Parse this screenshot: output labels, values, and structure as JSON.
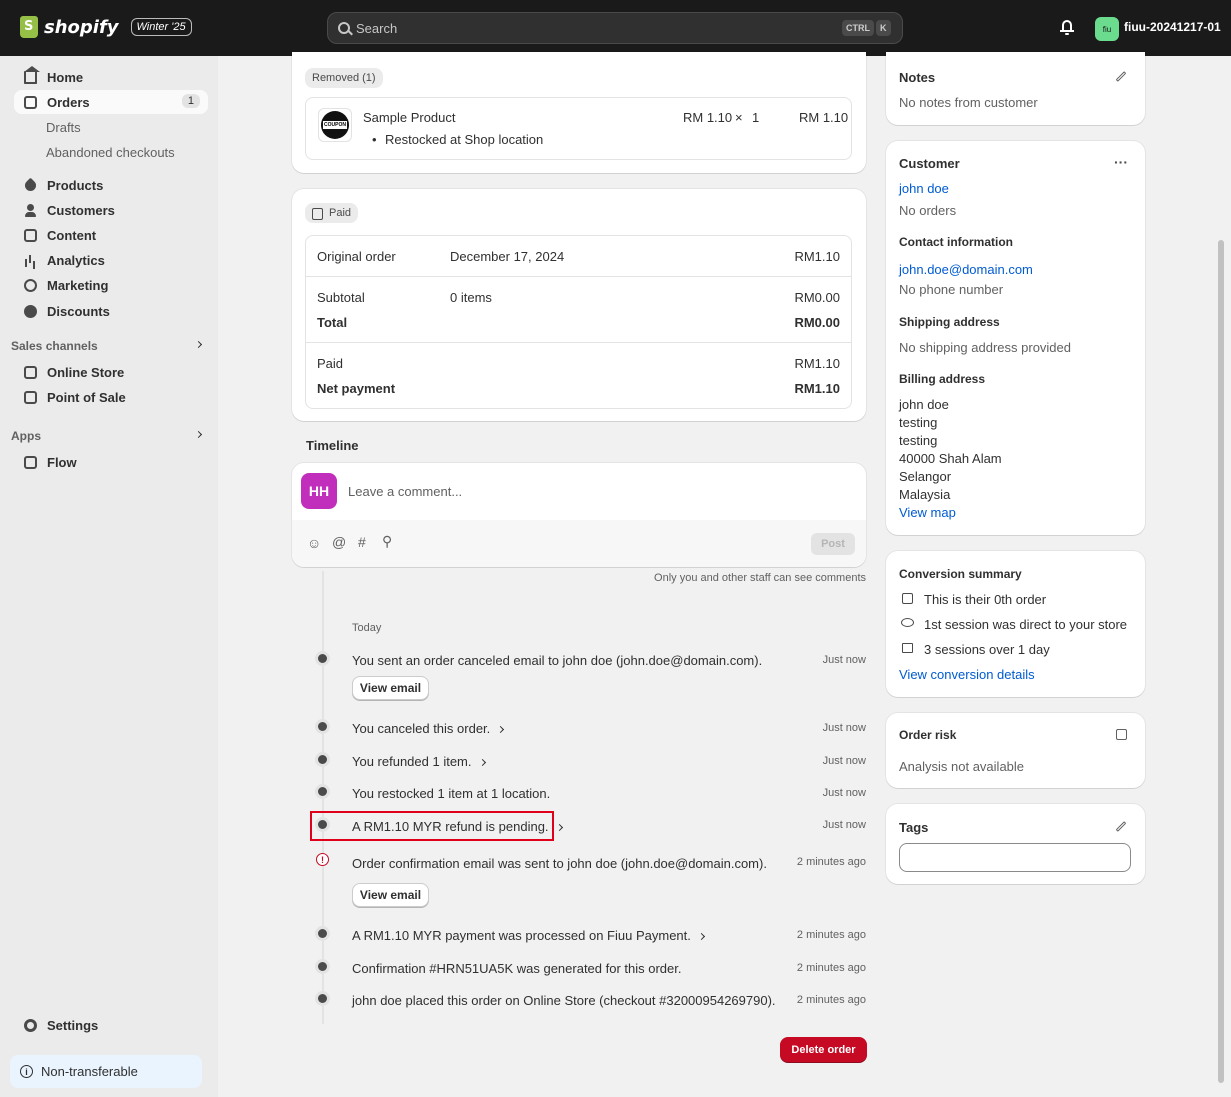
{
  "topbar": {
    "logo_text": "shopify",
    "edition_badge": "Winter '25",
    "search_placeholder": "Search",
    "kbd_ctrl": "CTRL",
    "kbd_k": "K",
    "store_avatar": "fiu",
    "store_name": "fiuu-20241217-01"
  },
  "sidebar": {
    "home": "Home",
    "orders": "Orders",
    "orders_count": "1",
    "drafts": "Drafts",
    "abandoned": "Abandoned checkouts",
    "products": "Products",
    "customers": "Customers",
    "content": "Content",
    "analytics": "Analytics",
    "marketing": "Marketing",
    "discounts": "Discounts",
    "sales_channels": "Sales channels",
    "online_store": "Online Store",
    "pos": "Point of Sale",
    "apps": "Apps",
    "flow": "Flow",
    "settings": "Settings",
    "non_transferable": "Non-transferable"
  },
  "removed_card": {
    "badge": "Removed (1)",
    "product_name": "Sample Product",
    "product_thumb_text": "COUPON",
    "price": "RM 1.10",
    "times": "×",
    "qty": "1",
    "total": "RM 1.10",
    "note": "Restocked at Shop location"
  },
  "paid_card": {
    "badge": "Paid",
    "original_order_label": "Original order",
    "original_order_date": "December 17, 2024",
    "original_order_amount": "RM1.10",
    "subtotal_label": "Subtotal",
    "subtotal_items": "0 items",
    "subtotal_amount": "RM0.00",
    "total_label": "Total",
    "total_amount": "RM0.00",
    "paid_label": "Paid",
    "paid_amount": "RM1.10",
    "net_label": "Net payment",
    "net_amount": "RM1.10"
  },
  "timeline": {
    "heading": "Timeline",
    "avatar_initials": "HH",
    "comment_placeholder": "Leave a comment...",
    "post_label": "Post",
    "staff_note": "Only you and other staff can see comments",
    "day_label": "Today",
    "view_email": "View email",
    "events": [
      {
        "text": "You sent an order canceled email to john doe (john.doe@domain.com).",
        "time": "Just now"
      },
      {
        "text": "You canceled this order.",
        "time": "Just now"
      },
      {
        "text": "You refunded 1 item.",
        "time": "Just now"
      },
      {
        "text": "You restocked 1 item at 1 location.",
        "time": "Just now"
      },
      {
        "text": "A RM1.10 MYR refund is pending.",
        "time": "Just now"
      },
      {
        "text": "Order confirmation email was sent to john doe (john.doe@domain.com).",
        "time": "2 minutes ago"
      },
      {
        "text": "A RM1.10 MYR payment was processed on Fiuu Payment.",
        "time": "2 minutes ago"
      },
      {
        "text": "Confirmation #HRN51UA5K was generated for this order.",
        "time": "2 minutes ago"
      },
      {
        "text": "john doe placed this order on Online Store (checkout #32000954269790).",
        "time": "2 minutes ago"
      }
    ],
    "delete_label": "Delete order"
  },
  "notes": {
    "title": "Notes",
    "text": "No notes from customer"
  },
  "customer": {
    "title": "Customer",
    "name": "john doe",
    "orders": "No orders",
    "contact_title": "Contact information",
    "email": "john.doe@domain.com",
    "phone": "No phone number",
    "shipping_title": "Shipping address",
    "shipping_text": "No shipping address provided",
    "billing_title": "Billing address",
    "billing_lines": [
      "john doe",
      "testing",
      "testing",
      "40000 Shah Alam",
      "Selangor",
      "Malaysia"
    ],
    "view_map": "View map"
  },
  "conversion": {
    "title": "Conversion summary",
    "line1": "This is their 0th order",
    "line2": "1st session was direct to your store",
    "line3": "3 sessions over 1 day",
    "link": "View conversion details"
  },
  "risk": {
    "title": "Order risk",
    "text": "Analysis not available"
  },
  "tags": {
    "title": "Tags",
    "input_value": ""
  },
  "colors": {
    "highlight": "#e0001b",
    "delete": "#c70a24",
    "link": "#005bd3"
  }
}
